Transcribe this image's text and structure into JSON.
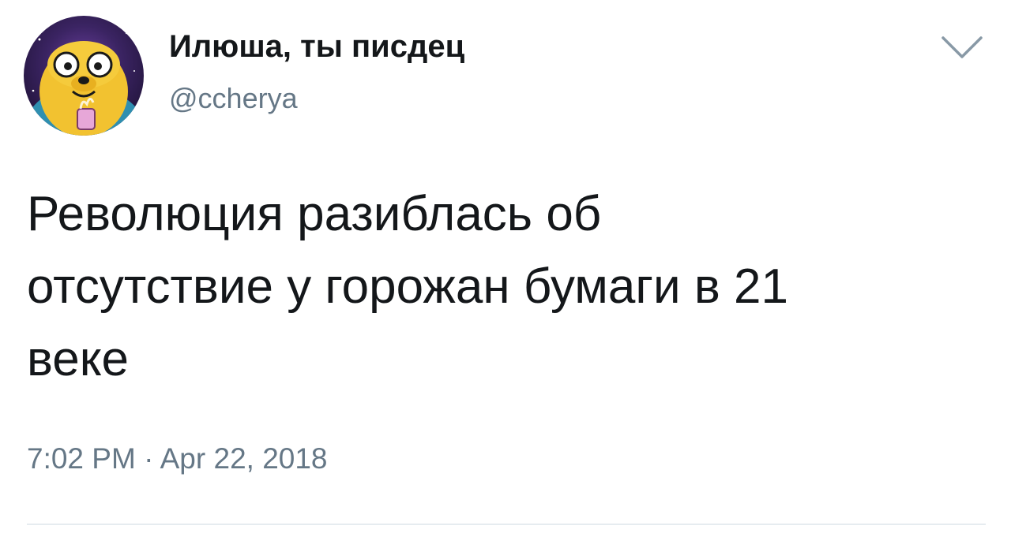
{
  "tweet": {
    "author": {
      "display_name": "Илюша, ты писдец",
      "handle": "@ccherya",
      "avatar_icon": "cartoon-dog-avatar"
    },
    "menu_icon": "chevron-down-icon",
    "text_lines": [
      "Революция разиблась об",
      "отсутствие у горожан бумаги в 21",
      "веке"
    ],
    "timestamp": "7:02 PM · Apr 22, 2018"
  },
  "colors": {
    "text_primary": "#14171a",
    "text_secondary": "#657786",
    "divider": "#e6ecf0",
    "chevron": "#8899a6"
  }
}
